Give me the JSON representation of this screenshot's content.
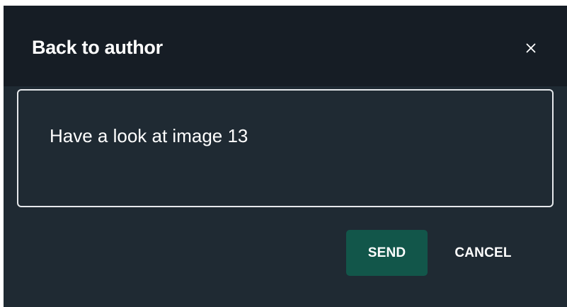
{
  "dialog": {
    "title": "Back to author",
    "close_icon": "close-icon",
    "message": "Have a look at image 13",
    "send_label": "SEND",
    "cancel_label": "CANCEL"
  },
  "colors": {
    "header_background": "#161d25",
    "body_background": "#1f2a33",
    "send_button": "#12564a",
    "text": "#ffffff",
    "input_border": "#e6e9ec"
  }
}
